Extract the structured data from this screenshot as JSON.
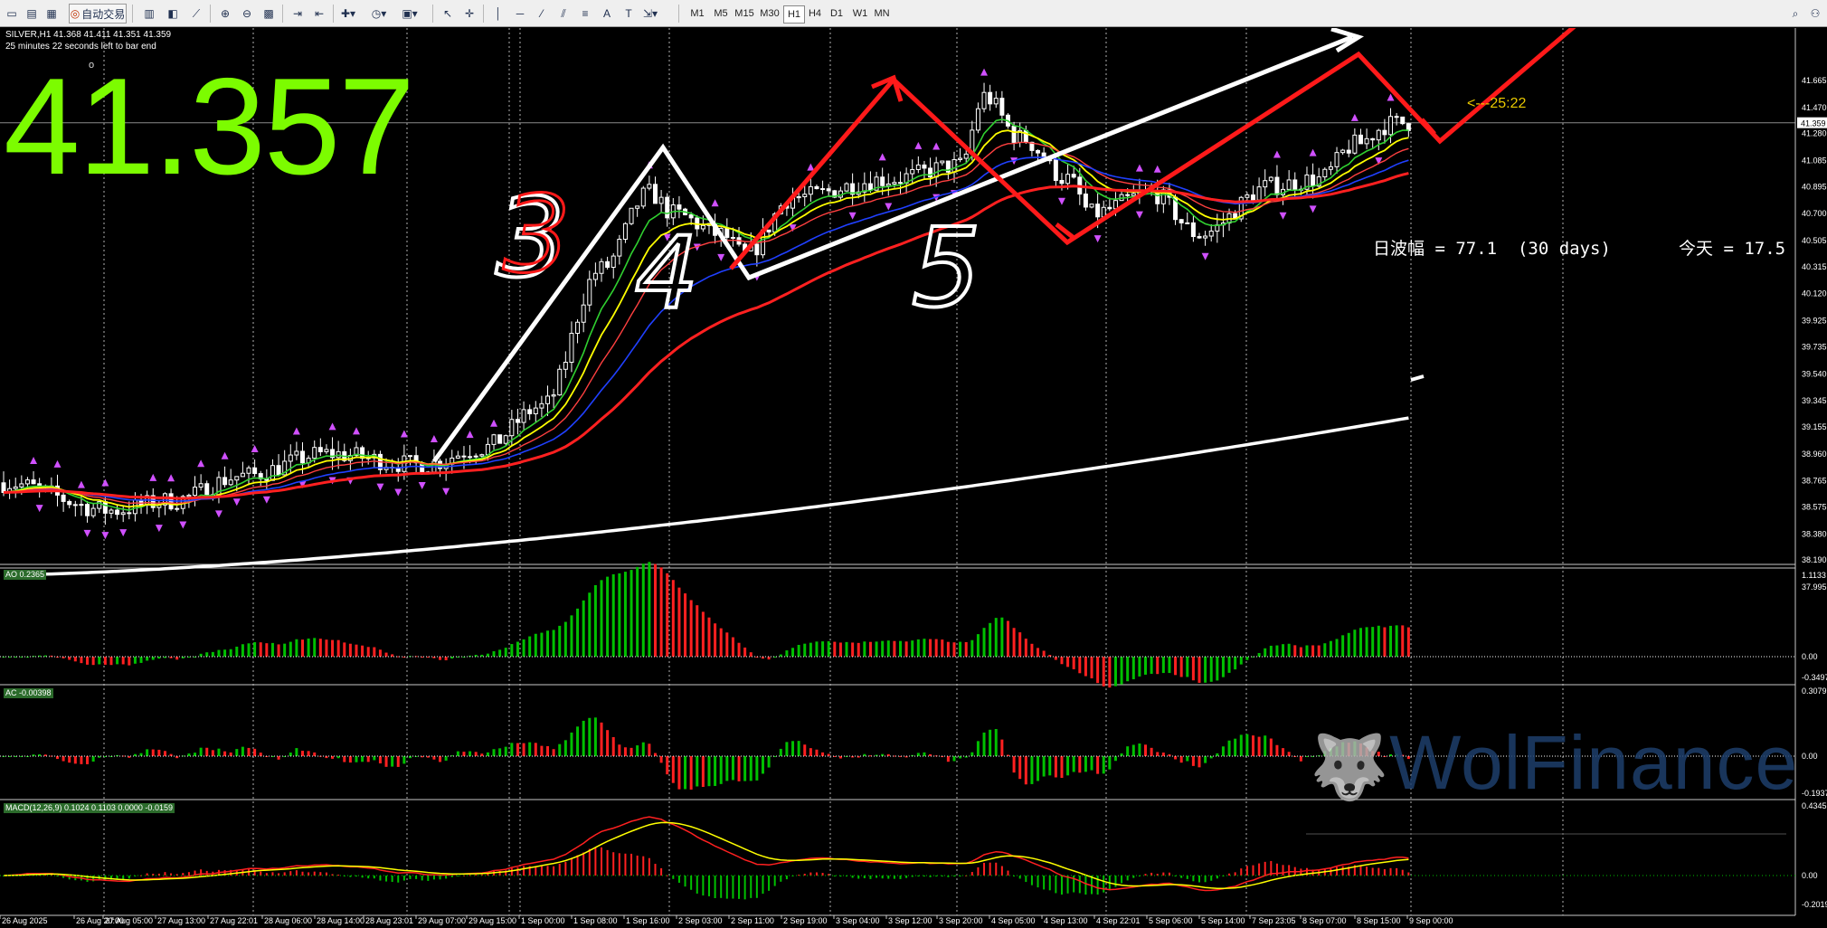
{
  "toolbar": {
    "auto_trade_label": "自动交易",
    "timeframes": [
      "M1",
      "M5",
      "M15",
      "M30",
      "H1",
      "H4",
      "D1",
      "W1",
      "MN"
    ]
  },
  "header": {
    "symbol_line": "SILVER,H1  41.368 41.411 41.351 41.359",
    "countdown_line": "25 minutes 22 seconds left to bar end",
    "small_marker": "o"
  },
  "big_price": "41.357",
  "timer_label": "<---25:22",
  "range_label": "日波幅 = 77.1  (30 days)",
  "today_label": "今天 = 17.5",
  "price_axis": {
    "labels": [
      "41.665",
      "41.470",
      "41.359",
      "41.280",
      "41.085",
      "40.895",
      "40.700",
      "40.505",
      "40.315",
      "40.120",
      "39.925",
      "39.735",
      "39.540",
      "39.345",
      "39.155",
      "38.960",
      "38.765",
      "38.575",
      "38.380",
      "38.190",
      "37.995"
    ],
    "current": "41.359"
  },
  "indicators": {
    "ao": {
      "label": "AO 0.2365",
      "top": "1.1133",
      "zero": "0.00",
      "bottom": "-0.3497"
    },
    "ac": {
      "label": "AC -0.00398",
      "top": "0.30791",
      "zero": "0.00",
      "bottom": "-0.19371"
    },
    "macd": {
      "label": "MACD(12,26,9) 0.1024 0.1103 0.0000 -0.0159",
      "top": "0.4345",
      "zero": "0.00",
      "bottom": "-0.2019"
    }
  },
  "time_axis": [
    "26 Aug 2025",
    "26 Aug 20:00",
    "27 Aug 05:00",
    "27 Aug 13:00",
    "27 Aug 22:01",
    "28 Aug 06:00",
    "28 Aug 14:00",
    "28 Aug 23:01",
    "29 Aug 07:00",
    "29 Aug 15:00",
    "1 Sep 00:00",
    "1 Sep 08:00",
    "1 Sep 16:00",
    "2 Sep 03:00",
    "2 Sep 11:00",
    "2 Sep 19:00",
    "3 Sep 04:00",
    "3 Sep 12:00",
    "3 Sep 20:00",
    "4 Sep 05:00",
    "4 Sep 13:00",
    "4 Sep 22:01",
    "5 Sep 06:00",
    "5 Sep 14:00",
    "7 Sep 23:05",
    "8 Sep 07:00",
    "8 Sep 15:00",
    "9 Sep 00:00"
  ],
  "annotations": [
    "3",
    "4",
    "5"
  ],
  "watermark": "WolFinance",
  "colors": {
    "background": "#000000",
    "bull": "#00c000",
    "bear": "#ff2020",
    "price_text": "#7cfc00",
    "ma_red": "#ff2020",
    "ma_yellow": "#ffff00",
    "ma_green": "#30d030",
    "ma_blue": "#2040ff",
    "ma_white": "#ffffff",
    "timer": "#e8c800"
  }
}
